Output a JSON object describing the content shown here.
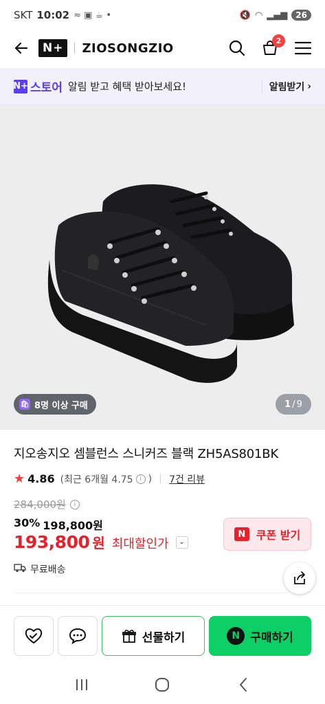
{
  "status_bar": {
    "carrier": "SKT",
    "time": "10:02",
    "battery": "26"
  },
  "header": {
    "logo": "N+",
    "store_name": "ZIOSONGZIO",
    "cart_count": "2"
  },
  "banner": {
    "brand": "스토어",
    "brand_mark": "N+",
    "message": "알림 받고 혜택 받아보세요!",
    "link_label": "알림받기"
  },
  "gallery": {
    "buyers_chip": "8명 이상 구매",
    "page_current": "1",
    "page_total": "9"
  },
  "product": {
    "title": "지오송지오 셈블런스 스니커즈 블랙 ZH5AS801BK",
    "rating": "4.86",
    "rating_recent": "(최근 6개월 4.75",
    "rating_recent_close": ")",
    "review_count": "7건 리뷰",
    "original_price": "284,000원",
    "discount_rate": "30%",
    "discount_price": "198,800원",
    "final_price": "193,800",
    "final_unit": "원",
    "final_label": "최대할인가",
    "coupon_label": "쿠폰 받기",
    "shipping": "무료배송"
  },
  "actions": {
    "gift_label": "선물하기",
    "buy_label": "구매하기"
  },
  "colors": {
    "accent": "#0cd065",
    "sale": "#e6212c",
    "brand_purple": "#5b3ef0"
  }
}
